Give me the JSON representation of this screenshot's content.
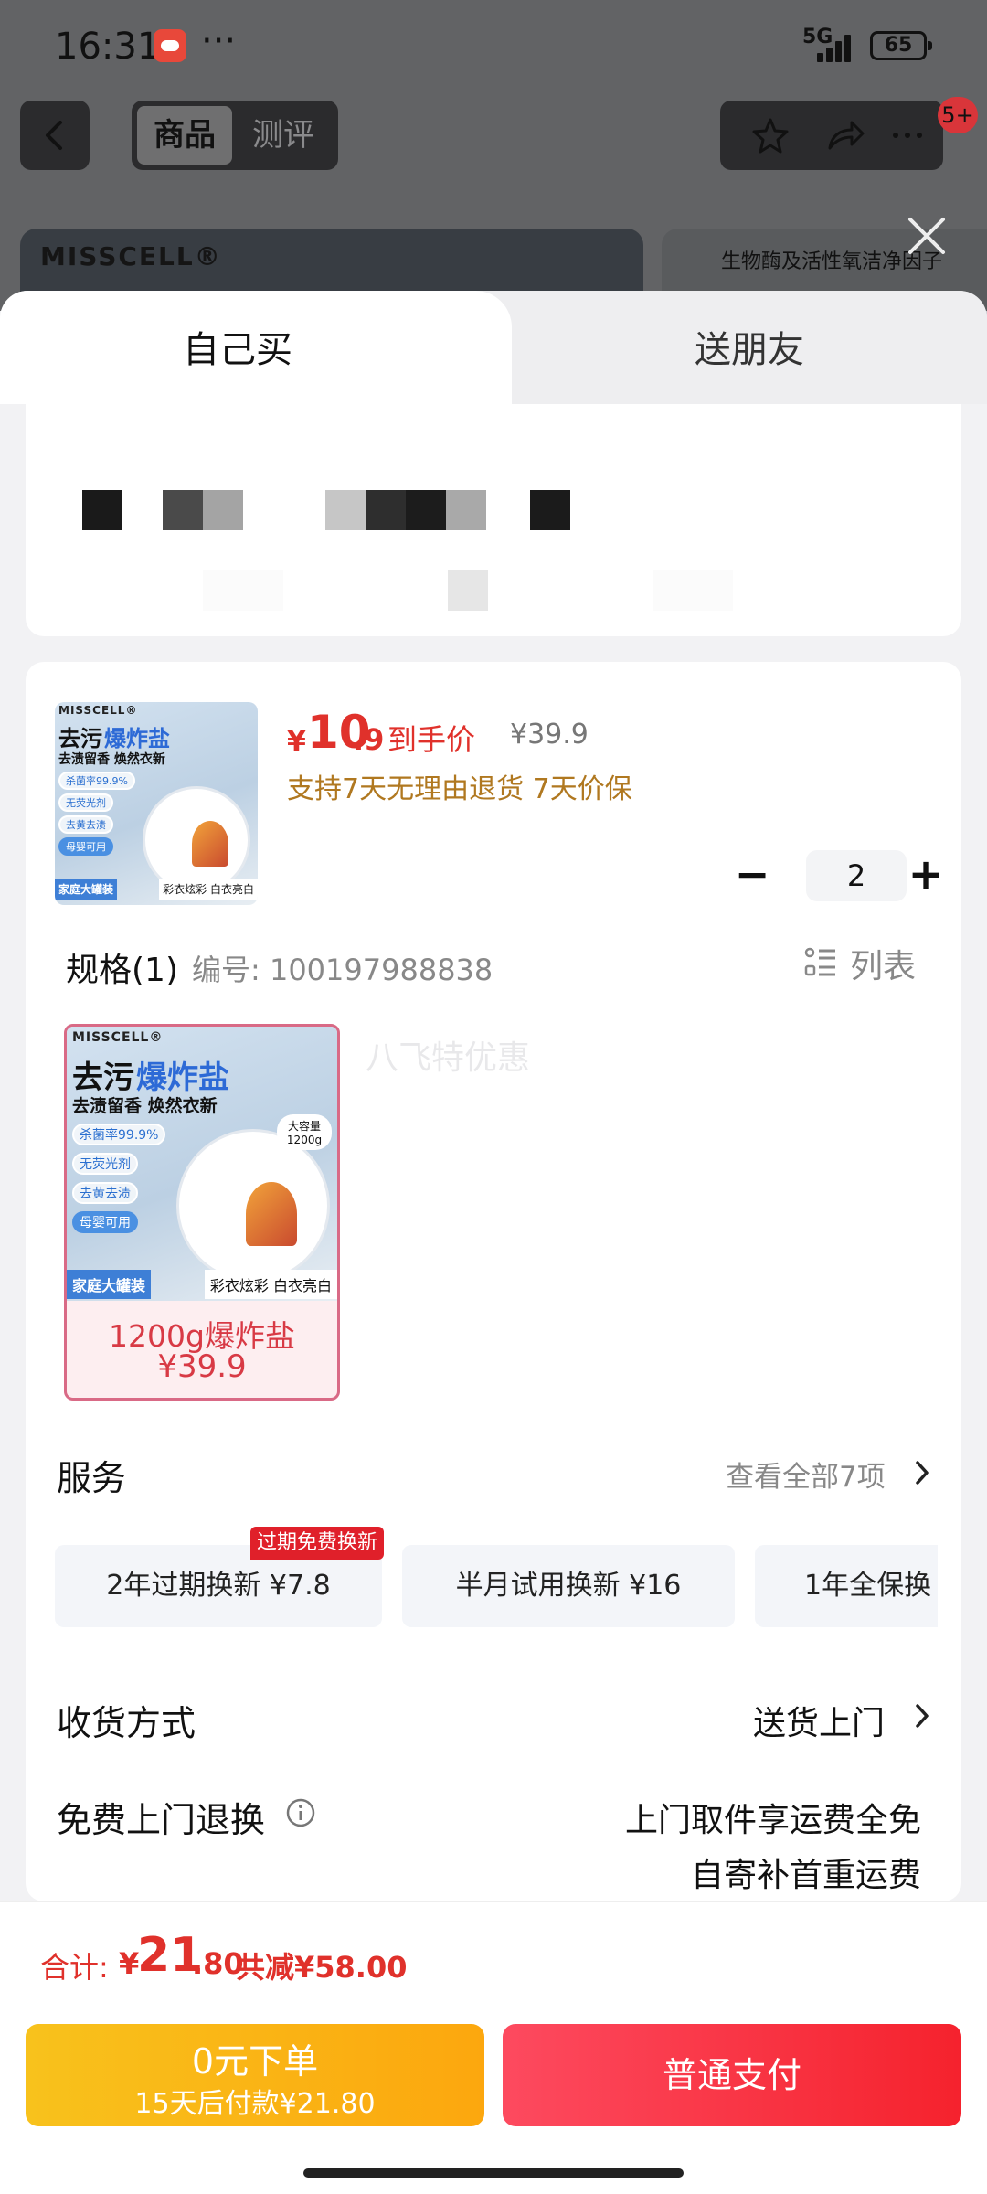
{
  "status": {
    "time": "16:31",
    "dots": "···",
    "network": "5G",
    "battery": "65"
  },
  "nav": {
    "tab_product": "商品",
    "tab_review": "测评",
    "badge": "5+"
  },
  "background": {
    "brand": "MISSCELL®",
    "side_text": "生物酶及活性氧洁净因子"
  },
  "sheet_tabs": {
    "self": "自己买",
    "friend": "送朋友"
  },
  "product": {
    "price_currency": "¥",
    "price_int": "10",
    "price_dec": ".9",
    "price_tag": "到手价",
    "original_price": "¥39.9",
    "guarantee": "支持7天无理由退货 7天价保",
    "quantity": "2",
    "image": {
      "brand": "MISSCELL®",
      "title_a": "去污",
      "title_b": "爆炸盐",
      "subtitle": "去渍留香 焕然衣新",
      "chips": [
        "杀菌率99.9%",
        "无荧光剂",
        "去黄去渍",
        "母婴可用"
      ],
      "footer_left": "家庭大罐装",
      "footer_right": "彩衣炫彩 白衣亮白",
      "capacity": "大容量 1200g"
    }
  },
  "spec": {
    "label": "规格(1)",
    "code": "编号: 100197988838",
    "list_label": "列表",
    "variant_name": "1200g爆炸盐",
    "variant_price": "¥39.9",
    "watermark": "八飞特优惠"
  },
  "service": {
    "title": "服务",
    "more": "查看全部7项",
    "tag": "过期免费换新",
    "items": [
      "2年过期换新 ¥7.8",
      "半月试用换新 ¥16",
      "1年全保换"
    ]
  },
  "delivery": {
    "label": "收货方式",
    "value": "送货上门"
  },
  "free_return": {
    "label": "免费上门退换",
    "line1": "上门取件享运费全免",
    "line2": "自寄补首重运费"
  },
  "total": {
    "label": "合计:",
    "currency": "¥",
    "int": "21",
    "dec": ".80",
    "saving": "共减¥58.00"
  },
  "pay": {
    "later_line1": "0元下单",
    "later_line2": "15天后付款¥21.80",
    "pay_now": "普通支付"
  },
  "colors": {
    "accent_red": "#e0312b",
    "pay_red": "#f5222d",
    "later_yellow": "#fca70e",
    "guarantee_gold": "#b07820"
  }
}
